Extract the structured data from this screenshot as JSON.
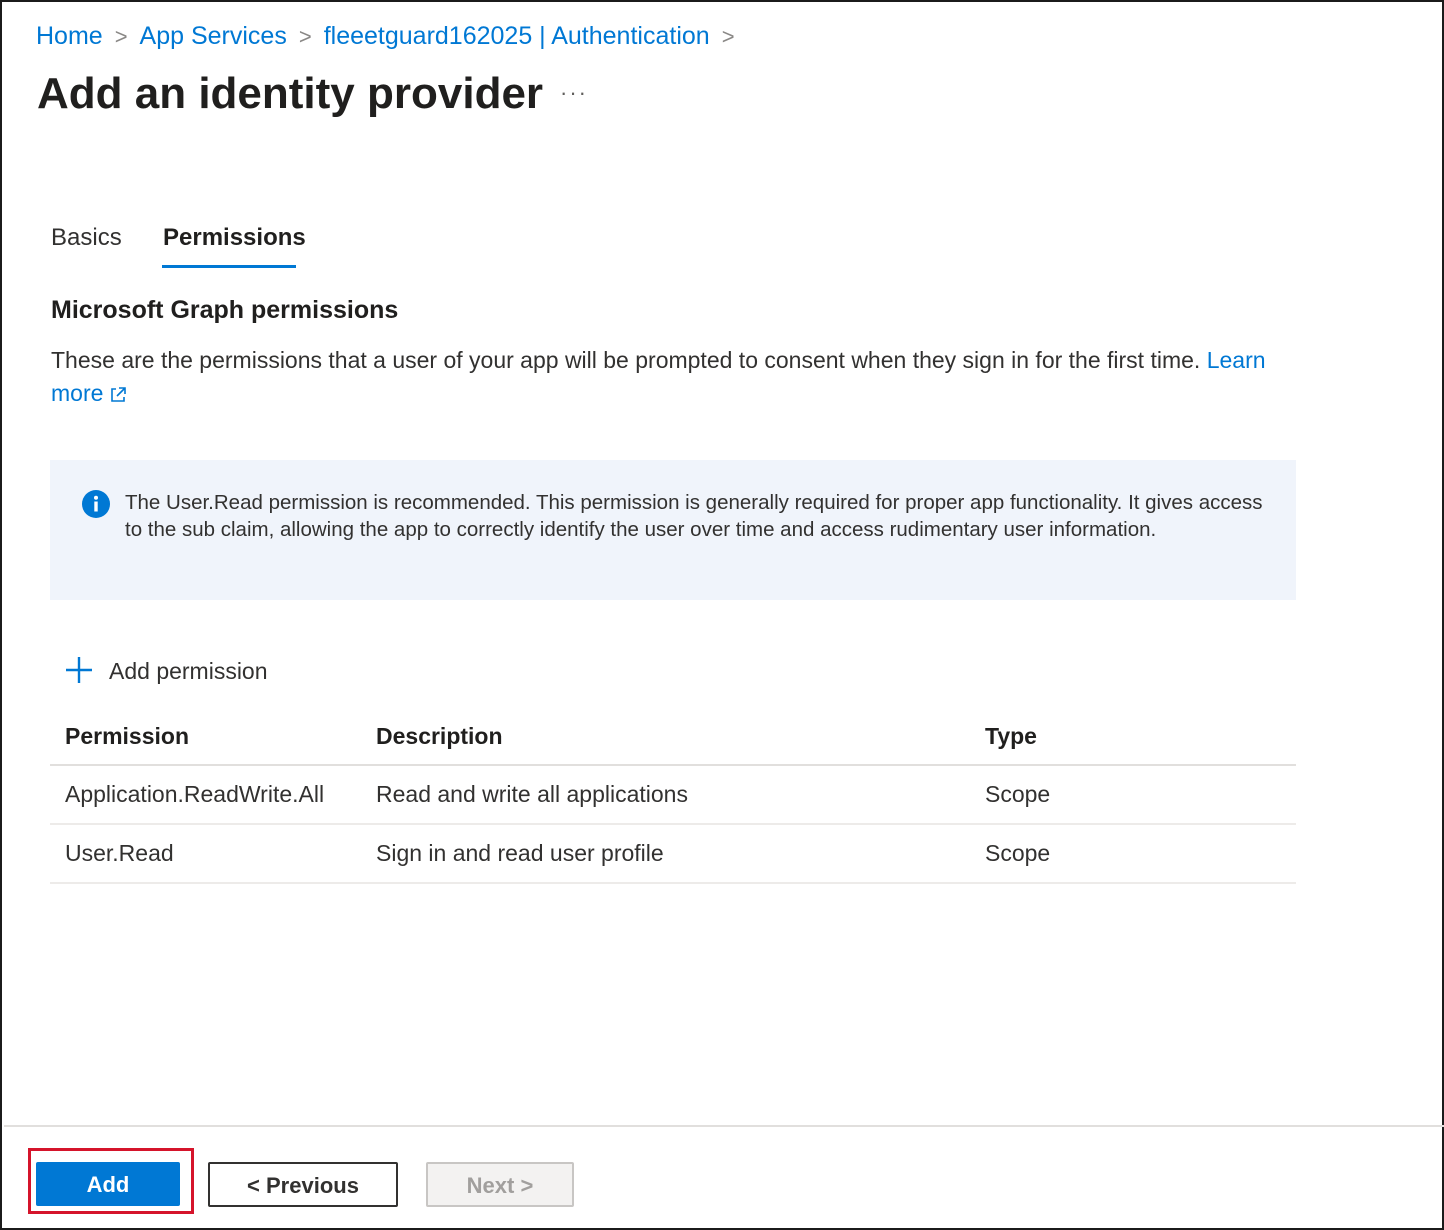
{
  "breadcrumb": {
    "items": [
      "Home",
      "App Services",
      "fleeetguard162025 | Authentication"
    ],
    "separator": ">"
  },
  "header": {
    "title": "Add an identity provider",
    "more_label": "···"
  },
  "tabs": [
    {
      "label": "Basics",
      "active": false
    },
    {
      "label": "Permissions",
      "active": true
    }
  ],
  "section": {
    "title": "Microsoft Graph permissions",
    "description": "These are the permissions that a user of your app will be prompted to consent when they sign in for the first time.",
    "learn_more_label": "Learn more"
  },
  "info": {
    "icon": "info-icon",
    "text": "The User.Read permission is recommended. This permission is generally required for proper app functionality. It gives access to the sub claim, allowing the app to correctly identify the user over time and access rudimentary user information."
  },
  "add_permission": {
    "icon": "plus-icon",
    "label": "Add permission"
  },
  "table": {
    "headers": {
      "permission": "Permission",
      "description": "Description",
      "type": "Type"
    },
    "rows": [
      {
        "permission": "Application.ReadWrite.All",
        "description": "Read and write all applications",
        "type": "Scope"
      },
      {
        "permission": "User.Read",
        "description": "Sign in and read user profile",
        "type": "Scope"
      }
    ]
  },
  "footer": {
    "add_label": "Add",
    "previous_label": "< Previous",
    "next_label": "Next >"
  },
  "colors": {
    "accent": "#0078d4",
    "highlight": "#d5142b",
    "info_background": "#f0f4fb"
  }
}
